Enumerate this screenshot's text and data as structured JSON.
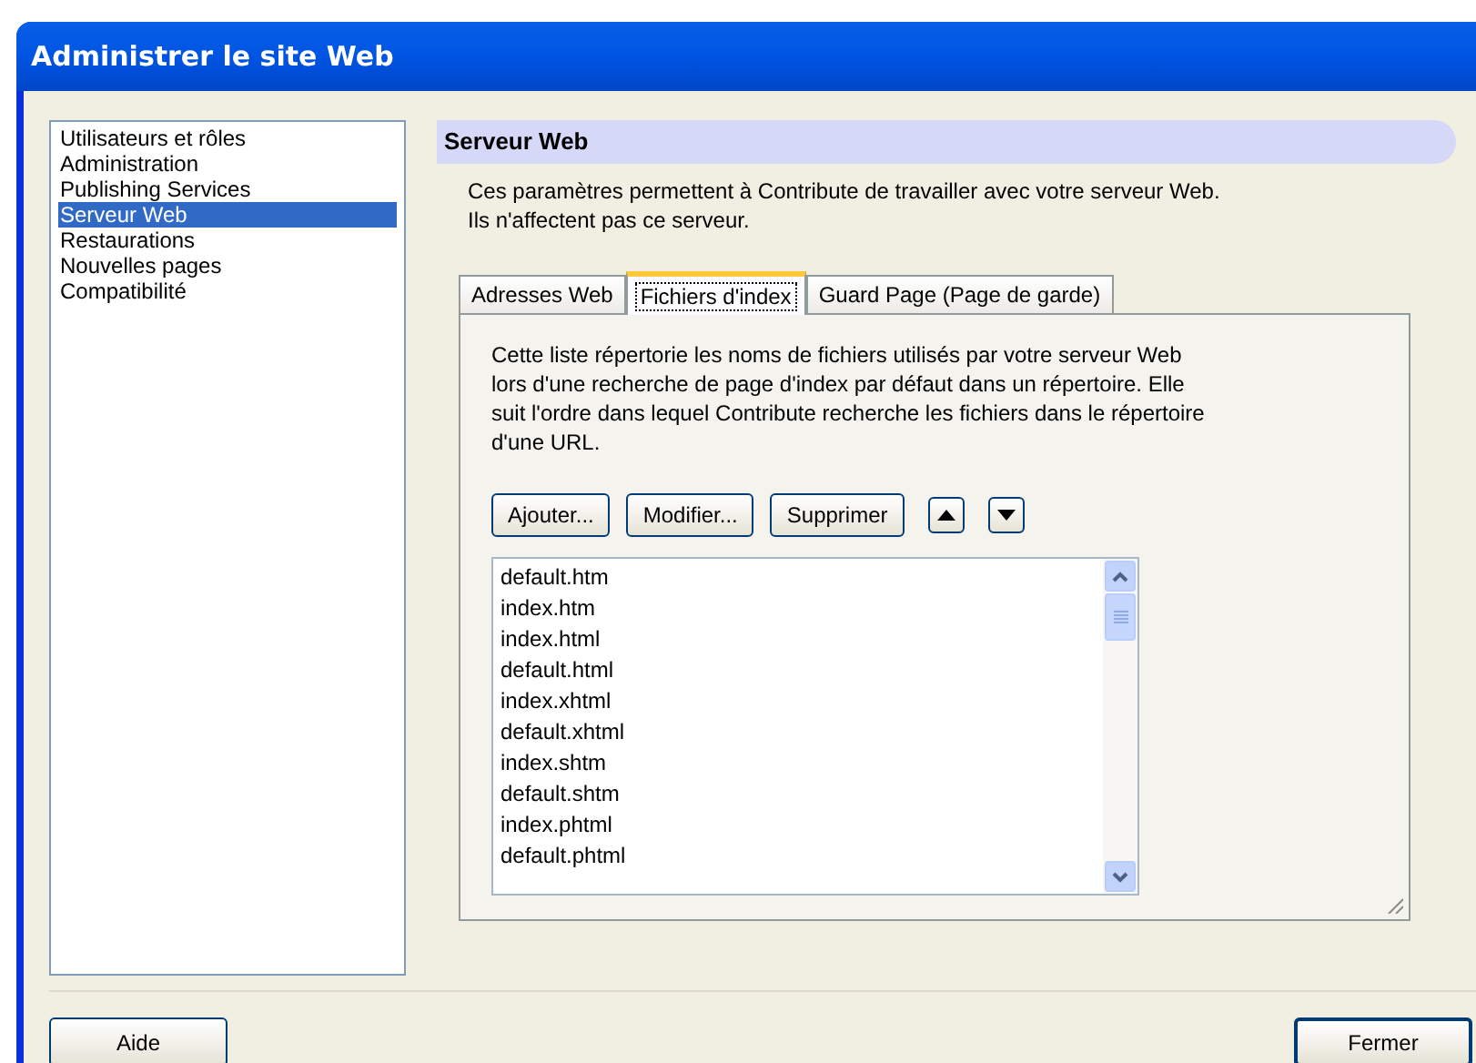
{
  "window": {
    "title": "Administrer le site Web"
  },
  "sidebar": {
    "items": [
      {
        "label": "Utilisateurs et rôles",
        "selected": false
      },
      {
        "label": "Administration",
        "selected": false
      },
      {
        "label": "Publishing Services",
        "selected": false
      },
      {
        "label": "Serveur Web",
        "selected": true
      },
      {
        "label": "Restaurations",
        "selected": false
      },
      {
        "label": "Nouvelles pages",
        "selected": false
      },
      {
        "label": "Compatibilité",
        "selected": false
      }
    ]
  },
  "section": {
    "title": "Serveur Web",
    "description": "Ces paramètres permettent à Contribute de travailler avec votre serveur Web.\nIls n'affectent pas ce serveur."
  },
  "tabs": [
    {
      "label": "Adresses Web",
      "selected": false
    },
    {
      "label": "Fichiers d'index",
      "selected": true
    },
    {
      "label": "Guard Page (Page de garde)",
      "selected": false
    }
  ],
  "tab_panel": {
    "description": "Cette liste répertorie les noms de fichiers utilisés par votre serveur Web\nlors d'une recherche de page d'index par défaut dans un répertoire. Elle\nsuit l'ordre dans lequel Contribute recherche les fichiers dans le répertoire\nd'une URL.",
    "buttons": [
      "Ajouter...",
      "Modifier...",
      "Supprimer"
    ],
    "files": [
      "default.htm",
      "index.htm",
      "index.html",
      "default.html",
      "index.xhtml",
      "default.xhtml",
      "index.shtm",
      "default.shtm",
      "index.phtml",
      "default.phtml"
    ]
  },
  "footer": {
    "buttons": [
      "Aide",
      "Fermer"
    ]
  }
}
